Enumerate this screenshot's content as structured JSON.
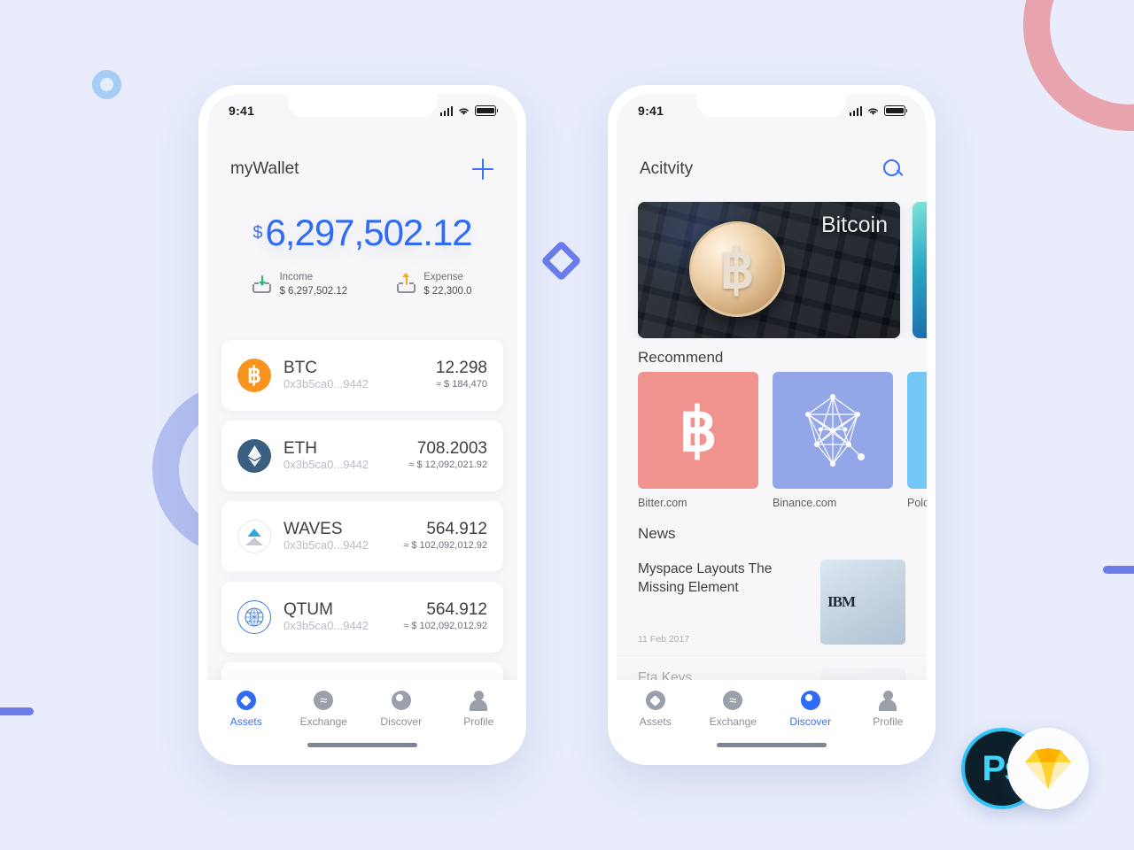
{
  "background": {
    "color": "#e8ecfb",
    "decorations": [
      {
        "name": "ring-pink",
        "color": "#e8a4ae"
      },
      {
        "name": "ring-purple",
        "color": "#b3bff0"
      },
      {
        "name": "ring-blue-small",
        "color": "#a6cdf5"
      },
      {
        "name": "diamond",
        "color": "#6b7ceb"
      },
      {
        "name": "bar-left",
        "color": "#6b7ceb"
      },
      {
        "name": "bar-right",
        "color": "#6b7ceb"
      }
    ]
  },
  "badges": {
    "photoshop_label": "Ps",
    "photoshop_color": "#40d4fb",
    "sketch_name": "sketch-diamond-icon"
  },
  "wallet_screen": {
    "status_bar": {
      "time": "9:41",
      "signal": "signal-icon",
      "wifi": "wifi-icon",
      "battery": "battery-icon"
    },
    "appbar": {
      "title": "myWallet",
      "action": "add-icon"
    },
    "balance": {
      "currency_symbol": "$",
      "amount": "6,297,502.12",
      "color": "#2f6bf5",
      "income": {
        "label": "Income",
        "value": "$ 6,297,502.12",
        "arrow_color": "#2bb673"
      },
      "expense": {
        "label": "Expense",
        "value": "$ 22,300.0",
        "arrow_color": "#f5a623"
      }
    },
    "assets": [
      {
        "symbol": "BTC",
        "address": "0x3b5ca0...9442",
        "amount": "12.298",
        "fiat": "≈ $ 184,470",
        "icon": "btc-coin-icon"
      },
      {
        "symbol": "ETH",
        "address": "0x3b5ca0...9442",
        "amount": "708.2003",
        "fiat": "≈ $ 12,092,021.92",
        "icon": "eth-coin-icon"
      },
      {
        "symbol": "WAVES",
        "address": "0x3b5ca0...9442",
        "amount": "564.912",
        "fiat": "≈ $ 102,092,012.92",
        "icon": "waves-coin-icon"
      },
      {
        "symbol": "QTUM",
        "address": "0x3b5ca0...9442",
        "amount": "564.912",
        "fiat": "≈ $ 102,092,012.92",
        "icon": "qtum-coin-icon"
      }
    ],
    "tabs": [
      {
        "label": "Assets",
        "active": true
      },
      {
        "label": "Exchange",
        "active": false
      },
      {
        "label": "Discover",
        "active": false
      },
      {
        "label": "Profile",
        "active": false
      }
    ]
  },
  "discover_screen": {
    "status_bar": {
      "time": "9:41"
    },
    "appbar": {
      "title": "Acitvity",
      "action": "search-icon"
    },
    "banner": {
      "title": "Bitcoin",
      "image": "bitcoin-coin-on-keyboard"
    },
    "recommend": {
      "heading": "Recommend",
      "items": [
        {
          "label": "Bitter.com",
          "icon": "bitcoin-b-icon",
          "color": "#f0938f"
        },
        {
          "label": "Binance.com",
          "icon": "network-mesh-icon",
          "color": "#93a6e8"
        },
        {
          "label": "Polone",
          "icon": "poloniex-icon",
          "color": "#73c8f5"
        }
      ]
    },
    "news": {
      "heading": "News",
      "items": [
        {
          "title": "Myspace Layouts The Missing Element",
          "date": "11 Feb 2017",
          "thumb": "ibm-servers-image"
        },
        {
          "title": "Fta Keys",
          "date": "",
          "thumb": "person-portrait-image"
        }
      ]
    },
    "tabs": [
      {
        "label": "Assets",
        "active": false
      },
      {
        "label": "Exchange",
        "active": false
      },
      {
        "label": "Discover",
        "active": true
      },
      {
        "label": "Profile",
        "active": false
      }
    ]
  }
}
